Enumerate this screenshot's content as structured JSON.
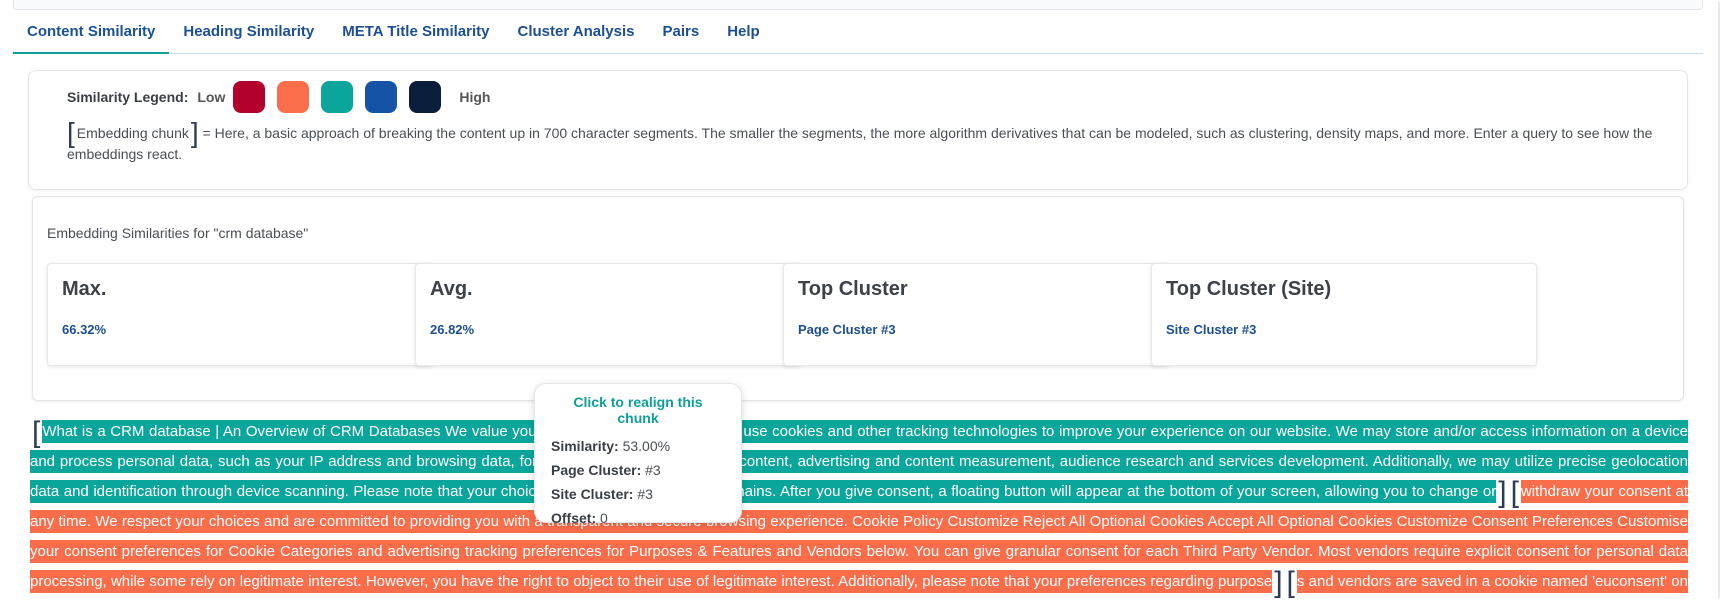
{
  "tabs": [
    {
      "label": "Content Similarity",
      "active": true
    },
    {
      "label": "Heading Similarity"
    },
    {
      "label": "META Title Similarity"
    },
    {
      "label": "Cluster Analysis"
    },
    {
      "label": "Pairs"
    },
    {
      "label": "Help"
    }
  ],
  "legend": {
    "title": "Similarity Legend:",
    "low_label": "Low",
    "high_label": "High",
    "colors": [
      "#b3002d",
      "#fa6e4b",
      "#0aa69b",
      "#1553a7",
      "#0a1e3c"
    ],
    "chunk_label": "Embedding chunk",
    "description": "= Here, a basic approach of breaking the content up in 700 character segments. The smaller the segments, the more algorithm derivatives that can be modeled, such as clustering, density maps, and more. Enter a query to see how the embeddings react."
  },
  "stats": {
    "heading": "Embedding Similarities for \"crm database\"",
    "max": {
      "label": "Max.",
      "value": "66.32%"
    },
    "avg": {
      "label": "Avg.",
      "value": "26.82%"
    },
    "top_cluster": {
      "label": "Top Cluster",
      "value": "Page Cluster #3"
    },
    "top_cluster_site": {
      "label": "Top Cluster (Site)",
      "value": "Site Cluster #3"
    }
  },
  "chunks": [
    {
      "color": "teal",
      "text": "What is a CRM database | An Overview of CRM Databases We value your privacy. We and our partners use cookies and other tracking technologies to improve your experience on our website. We may store and/or access information on a device and process personal data, such as your IP address and browsing data, for personalised advertising and content, advertising and content measurement, audience research and services development. Additionally, we may utilize precise geolocation data and identification through device scanning. Please note that your choices apply across all our subdomains. After you give consent, a floating button will appear at the bottom of your screen, allowing you to change or"
    },
    {
      "color": "orange",
      "text": "withdraw your consent at any time. We respect your choices and are committed to providing you with a transparent and secure browsing experience. Cookie Policy Customize Reject All Optional Cookies Accept All Optional Cookies Customize Consent Preferences Customise your consent preferences for Cookie Categories and advertising tracking preferences for Purposes & Features and Vendors below. You can give granular consent for each Third Party Vendor. Most vendors require explicit consent for personal data processing, while some rely on legitimate interest. However, you have the right to object to their use of legitimate interest. Additionally, please note that your preferences regarding purpose"
    },
    {
      "color": "orange",
      "text": "s and vendors are saved in a cookie named 'euconsent' on your device and may be retained for up to 730 days to remember your choices. Cookie"
    }
  ],
  "tooltip": {
    "title": "Click to realign this chunk",
    "similarity_label": "Similarity:",
    "similarity_value": "53.00%",
    "page_cluster_label": "Page Cluster:",
    "page_cluster_value": "#3",
    "site_cluster_label": "Site Cluster:",
    "site_cluster_value": "#3",
    "offset_label": "Offset:",
    "offset_value": "0"
  }
}
